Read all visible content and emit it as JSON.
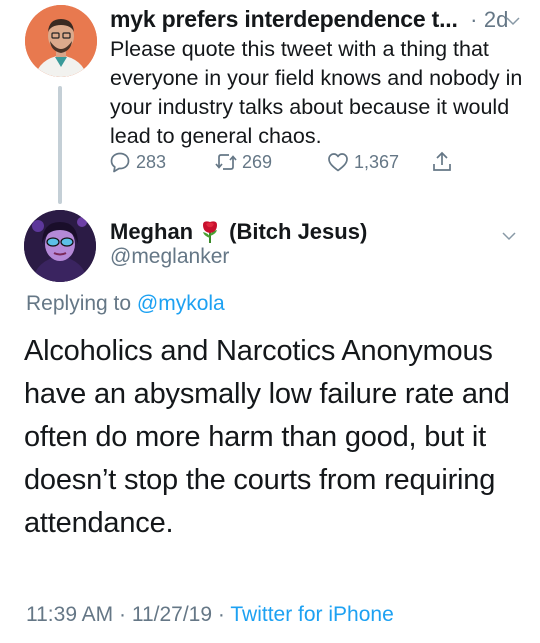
{
  "parent_tweet": {
    "display_name": "myk prefers interdependence t...",
    "separator": "·",
    "time": "2d",
    "text": "Please quote this tweet with a thing that everyone in your field knows and nobody in your industry talks about because it would lead to general chaos.",
    "reply_count": "283",
    "retweet_count": "269",
    "like_count": "1,367"
  },
  "main_tweet": {
    "display_name": "Meghan",
    "emoji": "rose-emoji",
    "alias": "(Bitch Jesus)",
    "handle": "@meglanker",
    "replying_prefix": "Replying to",
    "replying_to": "@mykola",
    "text": "Alcoholics and Narcotics Anonymous have an abysmally low failure rate and often do more harm than good, but it doesn’t stop the courts from requiring attendance.",
    "time": "11:39 AM",
    "date": "11/27/19",
    "separator": "·",
    "client": "Twitter for iPhone"
  },
  "colors": {
    "text_primary": "#14171a",
    "text_secondary": "#657786",
    "link": "#1da1f2",
    "thread_line": "#c4cfd6"
  }
}
